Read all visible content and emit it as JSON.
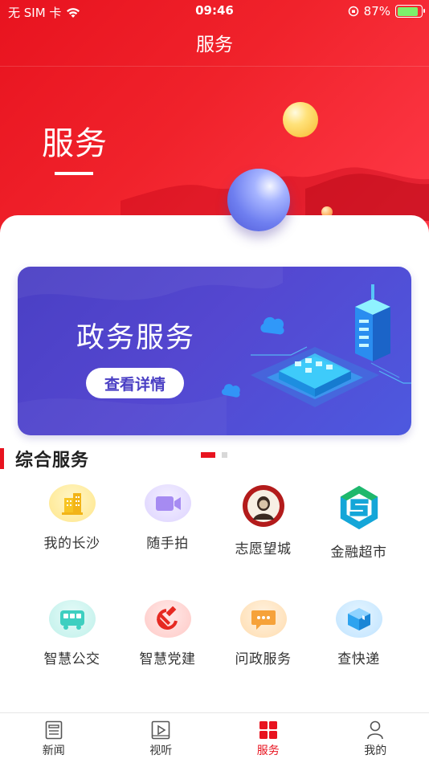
{
  "status_bar": {
    "carrier": "无 SIM 卡",
    "time": "09:46",
    "battery": "87%",
    "battery_level": 0.87
  },
  "nav": {
    "title": "服务"
  },
  "hero": {
    "title": "服务"
  },
  "banner": {
    "title": "政务服务",
    "button": "查看详情",
    "page_count": 2,
    "active_page": 1
  },
  "section": {
    "title": "综合服务"
  },
  "services": [
    {
      "label": "我的长沙",
      "icon": "building-icon"
    },
    {
      "label": "随手拍",
      "icon": "video-camera-icon"
    },
    {
      "label": "志愿望城",
      "icon": "volunteer-logo-icon"
    },
    {
      "label": "金融超市",
      "icon": "finance-logo-icon"
    },
    {
      "label": "智慧公交",
      "icon": "bus-icon"
    },
    {
      "label": "智慧党建",
      "icon": "hammer-sickle-icon"
    },
    {
      "label": "问政服务",
      "icon": "chat-bubble-icon"
    },
    {
      "label": "查快递",
      "icon": "package-box-icon"
    }
  ],
  "tabbar": [
    {
      "label": "新闻",
      "icon": "news-icon",
      "active": false
    },
    {
      "label": "视听",
      "icon": "play-icon",
      "active": false
    },
    {
      "label": "服务",
      "icon": "grid-icon",
      "active": true
    },
    {
      "label": "我的",
      "icon": "user-icon",
      "active": false
    }
  ],
  "colors": {
    "brand_red": "#e8131f",
    "banner_purple": "#4a3fc4"
  }
}
